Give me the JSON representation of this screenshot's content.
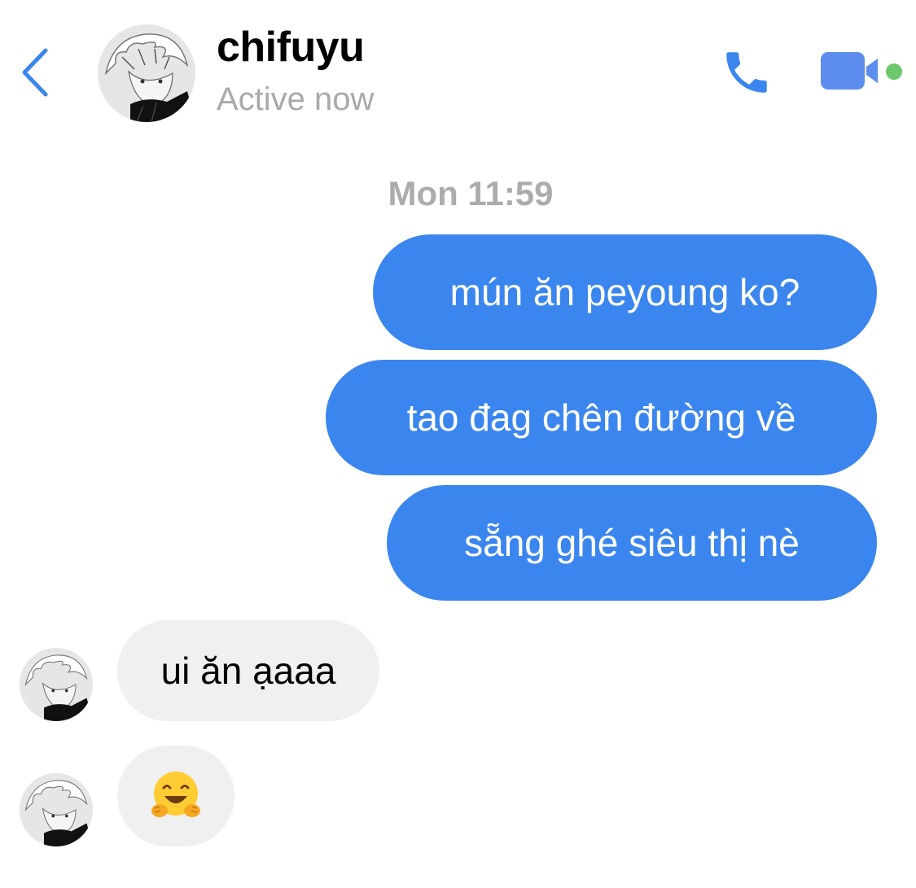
{
  "header": {
    "contact_name": "chifuyu",
    "status": "Active now",
    "icons": {
      "back": "chevron-left-icon",
      "call": "phone-icon",
      "video": "video-camera-icon"
    },
    "accent_color": "#3b86ee",
    "online_color": "#6cc86a"
  },
  "conversation": {
    "timestamp": "Mon 11:59",
    "messages": [
      {
        "direction": "outgoing",
        "text": "mún ăn peyoung ko?"
      },
      {
        "direction": "outgoing",
        "text": "tao đag chên đường về"
      },
      {
        "direction": "outgoing",
        "text": "sẵng ghé siêu thị nè"
      },
      {
        "direction": "incoming",
        "text": "ui ăn ạaaa"
      },
      {
        "direction": "incoming",
        "emoji": "hugging-face"
      }
    ]
  }
}
